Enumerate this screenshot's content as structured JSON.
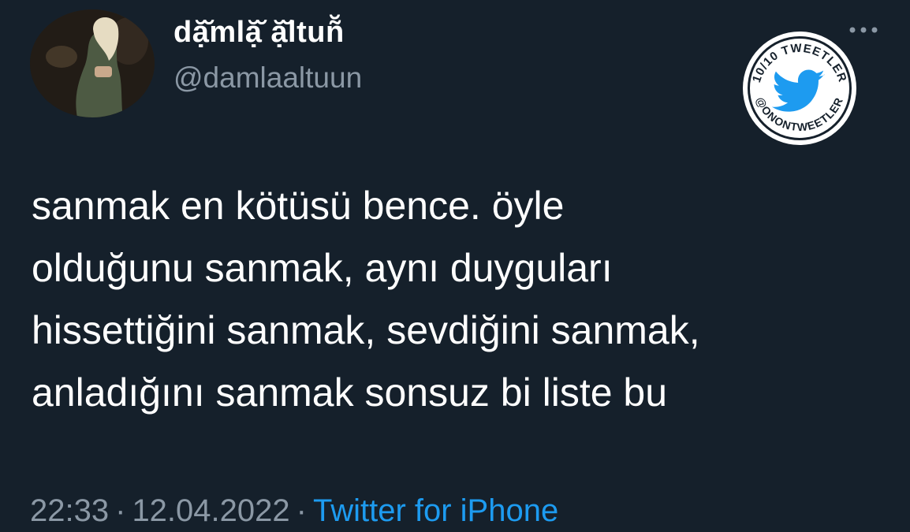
{
  "user": {
    "display_name": "dặ̆mlặ̆ ặ̆ltuñ̆",
    "handle": "@damlaaltuun"
  },
  "badge": {
    "top_text": "10/10 TWEETLER",
    "bottom_text": "@ONONTWEETLER",
    "icon": "twitter-bird-icon"
  },
  "tweet": {
    "lines": [
      "sanmak en kötüsü bence. öyle",
      "olduğunu sanmak, aynı duyguları",
      "hissettiğini sanmak, sevdiğini sanmak,",
      "anladığını sanmak sonsuz bi liste bu"
    ]
  },
  "meta": {
    "time": "22:33",
    "separator": "·",
    "date": "12.04.2022",
    "source": "Twitter for iPhone"
  },
  "colors": {
    "background": "#15202b",
    "text": "#ffffff",
    "muted": "#8b98a5",
    "accent": "#1d9bf0"
  },
  "icons": {
    "more": "more-icon"
  }
}
